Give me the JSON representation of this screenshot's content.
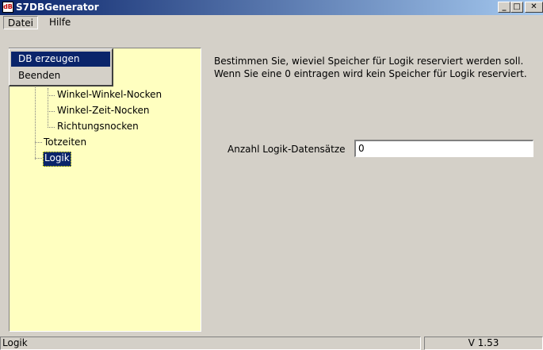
{
  "window": {
    "title": "S7DBGenerator",
    "icon_label": "dB",
    "minimize_glyph": "_",
    "maximize_glyph": "□",
    "close_glyph": "✕"
  },
  "menubar": {
    "items": [
      {
        "label": "Datei"
      },
      {
        "label": "Hilfe"
      }
    ]
  },
  "datei_menu": {
    "items": [
      {
        "label": "DB erzeugen"
      },
      {
        "label": "Beenden"
      }
    ]
  },
  "tree": {
    "nodes": [
      {
        "label": "Winkel-Winkel-Nocken"
      },
      {
        "label": "Winkel-Zeit-Nocken"
      },
      {
        "label": "Richtungsnocken"
      },
      {
        "label": "Totzeiten"
      },
      {
        "label": "Logik"
      }
    ],
    "selected": "Logik"
  },
  "main": {
    "description_line1": "Bestimmen Sie, wieviel Speicher für Logik reserviert werden soll.",
    "description_line2": "Wenn Sie eine 0 eintragen wird kein Speicher für Logik reserviert.",
    "field_label": "Anzahl Logik-Datensätze",
    "field_value": "0"
  },
  "statusbar": {
    "text": "Logik",
    "version": "V 1.53"
  }
}
